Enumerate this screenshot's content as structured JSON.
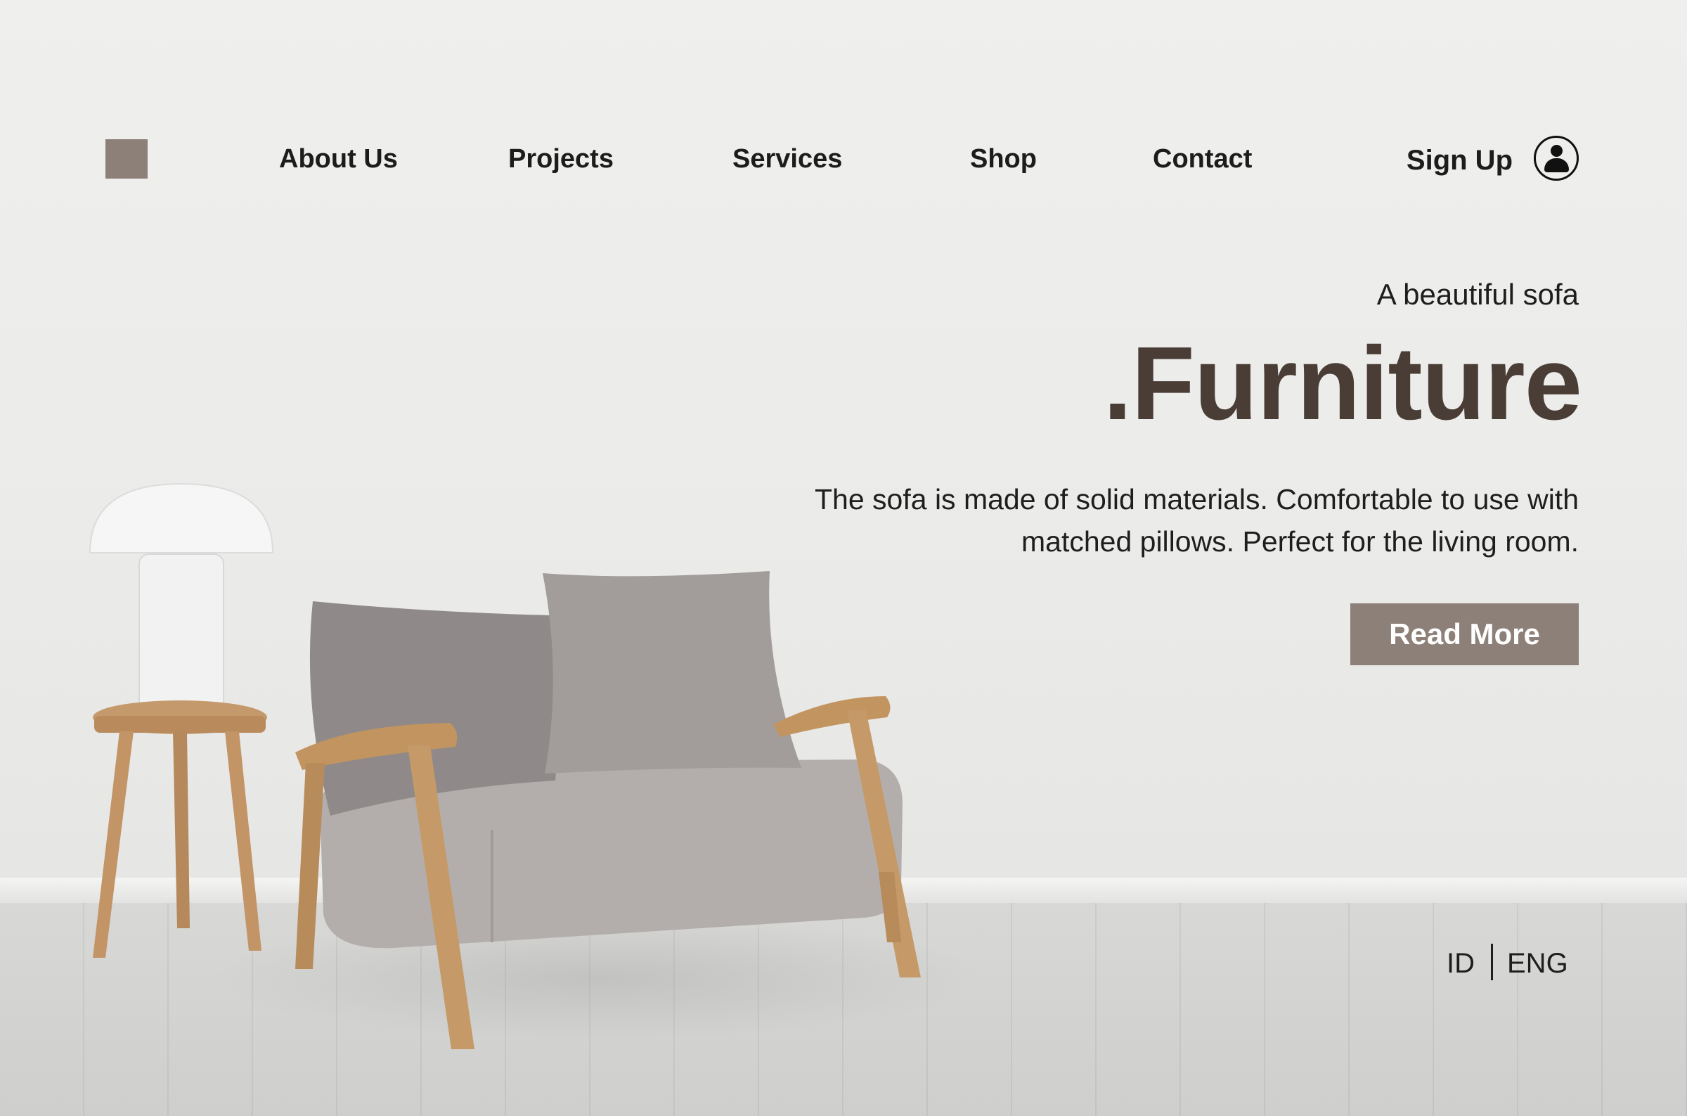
{
  "nav": {
    "items": [
      {
        "label": "About Us"
      },
      {
        "label": "Projects"
      },
      {
        "label": "Services"
      },
      {
        "label": "Shop"
      },
      {
        "label": "Contact"
      }
    ],
    "signup_label": "Sign Up",
    "logo_color": "#8d8078",
    "user_icon": "user-icon"
  },
  "hero": {
    "tagline": "A beautiful sofa",
    "headline": ".Furniture",
    "description": "The sofa is made of solid materials. Comfortable to use with matched pillows. Perfect for the living room.",
    "cta_label": "Read More",
    "headline_color": "#4a3d36",
    "cta_color": "#8d8078"
  },
  "language": {
    "options": [
      {
        "label": "ID"
      },
      {
        "label": "ENG"
      }
    ]
  }
}
